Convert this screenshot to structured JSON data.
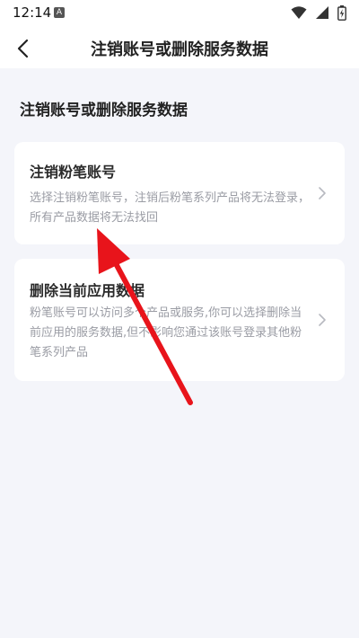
{
  "status_bar": {
    "time": "12:14",
    "a_badge": "A",
    "icons": [
      "wifi-icon",
      "signal-icon",
      "battery-charging-icon"
    ]
  },
  "nav": {
    "back_icon": "chevron-left-icon",
    "title": "注销账号或删除服务数据"
  },
  "section_title": "注销账号或删除服务数据",
  "options": [
    {
      "title": "注销粉笔账号",
      "description": "选择注销粉笔账号，注销后粉笔系列产品将无法登录，所有产品数据将无法找回",
      "icon": "chevron-right-icon"
    },
    {
      "title": "删除当前应用数据",
      "description": "粉笔账号可以访问多个产品或服务,你可以选择删除当前应用的服务数据,但不影响您通过该账号登录其他粉笔系列产品",
      "icon": "chevron-right-icon"
    }
  ],
  "colors": {
    "background": "#f4f5fa",
    "card": "#ffffff",
    "annotation_arrow": "#e8141b",
    "description_text": "#9a9ca4"
  }
}
